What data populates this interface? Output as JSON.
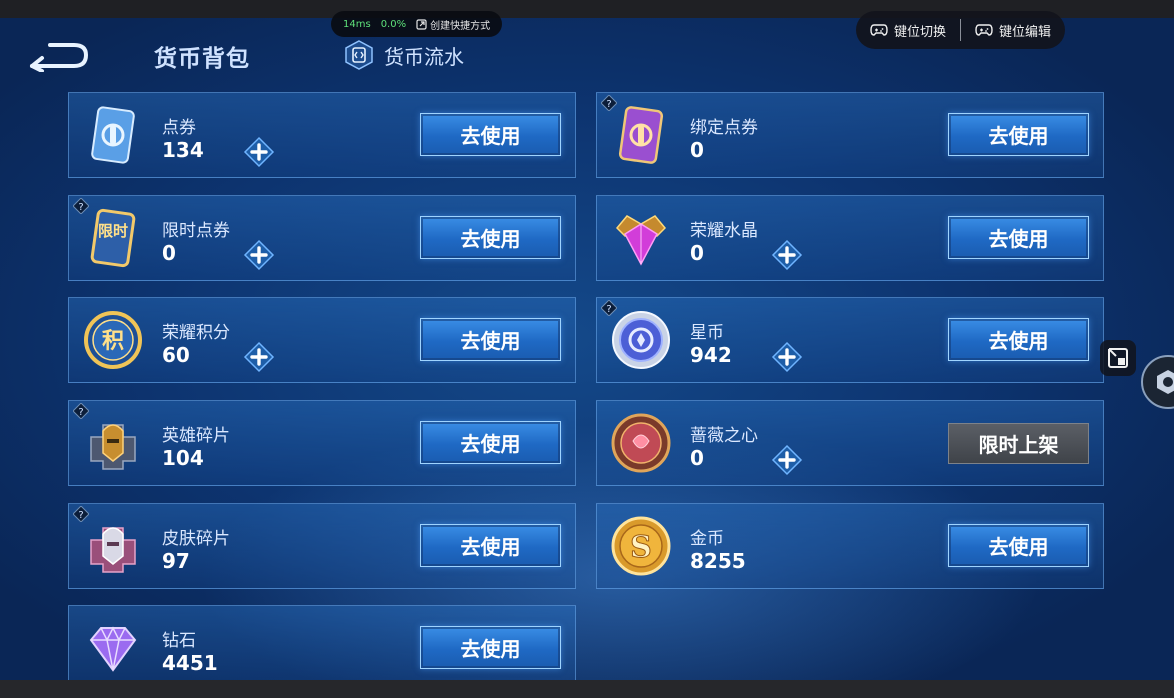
{
  "header": {
    "title": "货币背包",
    "flow_tab": "货币流水"
  },
  "overlay": {
    "perf_ms": "14ms",
    "perf_pct": "0.0%",
    "shortcut_label": "创建快捷方式",
    "key_switch": "键位切换",
    "key_edit": "键位编辑"
  },
  "currencies": [
    {
      "name": "点券",
      "value": "134",
      "button": "去使用",
      "icon": "ticket-blue-icon"
    },
    {
      "name": "绑定点券",
      "value": "0",
      "button": "去使用",
      "icon": "ticket-purple-icon"
    },
    {
      "name": "限时点券",
      "value": "0",
      "button": "去使用",
      "icon": "limited-ticket-icon",
      "icon_text": "限时"
    },
    {
      "name": "荣耀水晶",
      "value": "0",
      "button": "去使用",
      "icon": "glory-crystal-icon"
    },
    {
      "name": "荣耀积分",
      "value": "60",
      "button": "去使用",
      "icon": "glory-points-icon",
      "icon_text": "积"
    },
    {
      "name": "星币",
      "value": "942",
      "button": "去使用",
      "icon": "star-coin-icon"
    },
    {
      "name": "英雄碎片",
      "value": "104",
      "button": "去使用",
      "icon": "hero-fragment-icon"
    },
    {
      "name": "蔷薇之心",
      "value": "0",
      "button": "限时上架",
      "icon": "rose-heart-icon"
    },
    {
      "name": "皮肤碎片",
      "value": "97",
      "button": "去使用",
      "icon": "skin-fragment-icon"
    },
    {
      "name": "金币",
      "value": "8255",
      "button": "去使用",
      "icon": "gold-coin-icon",
      "icon_text": "S"
    },
    {
      "name": "钻石",
      "value": "4451",
      "button": "去使用",
      "icon": "diamond-icon"
    }
  ]
}
